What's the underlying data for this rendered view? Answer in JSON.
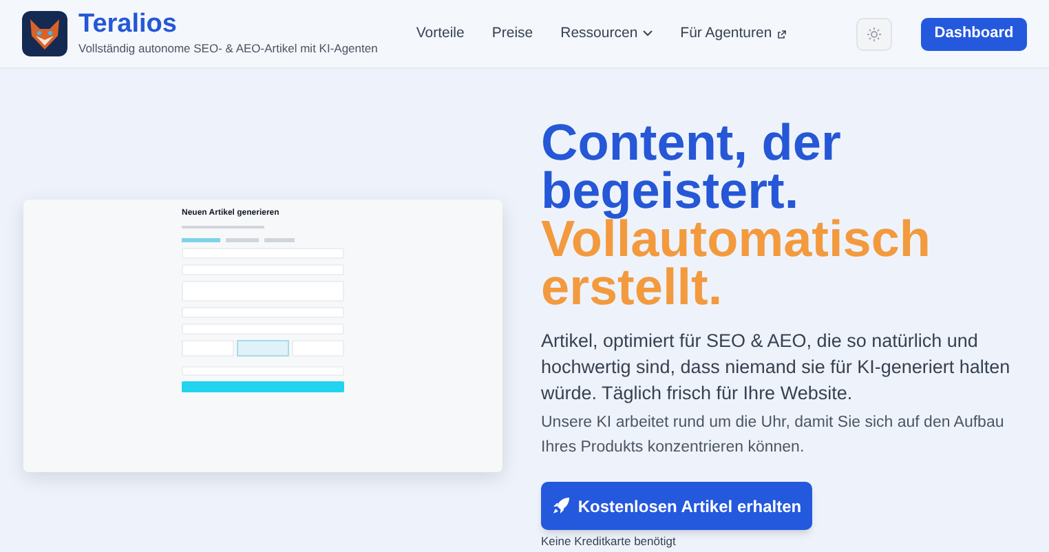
{
  "brand": {
    "name": "Teralios",
    "tagline": "Vollständig autonome SEO- & AEO-Artikel mit KI-Agenten"
  },
  "nav": [
    {
      "label": "Vorteile",
      "kind": "link"
    },
    {
      "label": "Preise",
      "kind": "link"
    },
    {
      "label": "Ressourcen",
      "kind": "dropdown"
    },
    {
      "label": "Für Agenturen",
      "kind": "external"
    }
  ],
  "dashboard_button": "Dashboard",
  "preview": {
    "title": "Neuen Artikel generieren"
  },
  "hero": {
    "headline": [
      {
        "text": "Content, der",
        "accent": false
      },
      {
        "text": "begeistert.",
        "accent": false
      },
      {
        "text": "Vollautomatisch",
        "accent": true
      },
      {
        "text": "erstellt.",
        "accent": true
      }
    ],
    "lead": "Artikel, optimiert für SEO & AEO, die so natürlich und hochwertig sind, dass niemand sie für KI-generiert halten würde. Täglich frisch für Ihre Website.",
    "sub": "Unsere KI arbeitet rund um die Uhr, damit Sie sich auf den Aufbau Ihres Produkts konzentrieren können.",
    "cta": "Kostenlosen Artikel erhalten",
    "note": "Keine Kreditkarte benötigt"
  }
}
